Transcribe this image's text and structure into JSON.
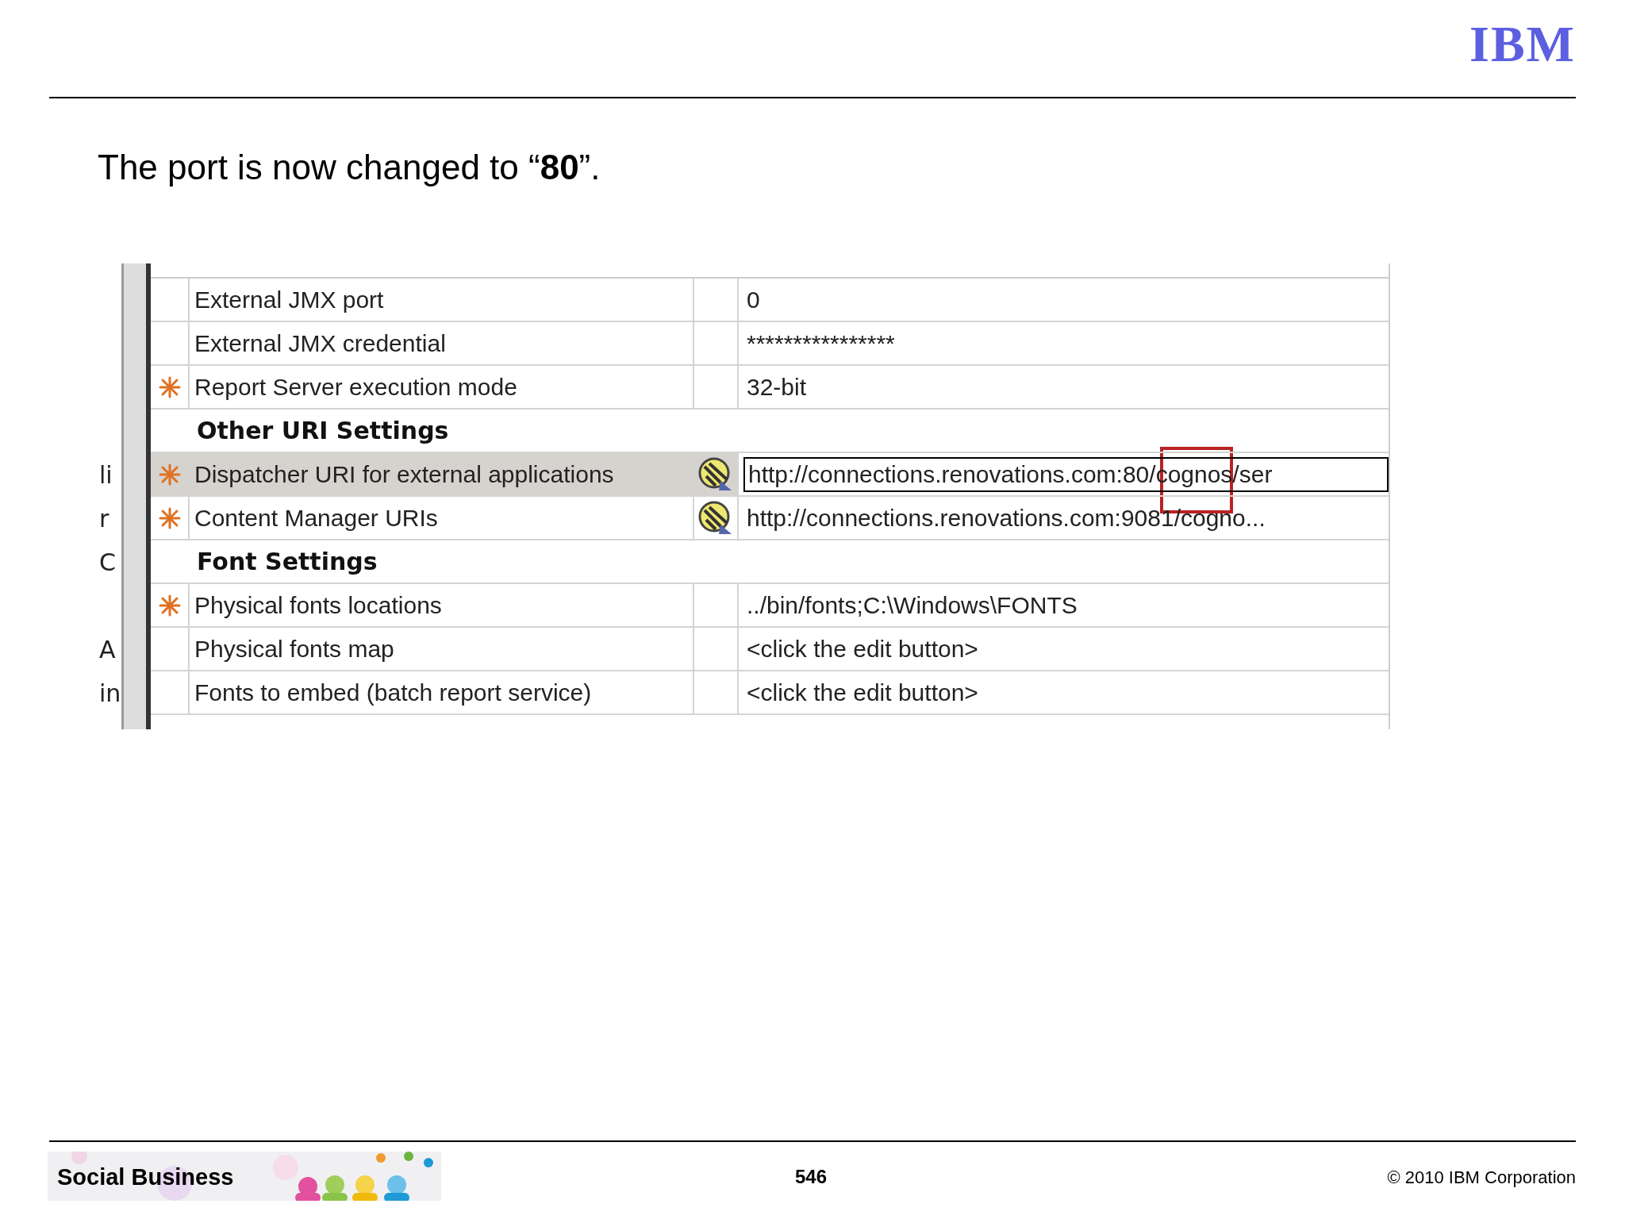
{
  "logo": "IBM",
  "title": "The port is now changed to “**80**”.",
  "table": {
    "rows": [
      {
        "kind": "setting",
        "required": false,
        "name": "External JMX port",
        "has_icon": false,
        "value": "0",
        "selected": false,
        "editing": false
      },
      {
        "kind": "setting",
        "required": false,
        "name": "External JMX credential",
        "has_icon": false,
        "value": "****************",
        "selected": false,
        "editing": false
      },
      {
        "kind": "setting",
        "required": true,
        "name": "Report Server execution mode",
        "has_icon": false,
        "value": "32-bit",
        "selected": false,
        "editing": false
      },
      {
        "kind": "group",
        "name": "Other URI Settings"
      },
      {
        "kind": "setting",
        "required": true,
        "name": "Dispatcher URI for external applications",
        "has_icon": true,
        "value": "http://connections.renovations.com:80/cognos/ser",
        "selected": true,
        "editing": true,
        "callout": true,
        "side_text": "li"
      },
      {
        "kind": "setting",
        "required": true,
        "name": "Content Manager URIs",
        "has_icon": true,
        "value": "http://connections.renovations.com:9081/cogno...",
        "selected": false,
        "editing": false,
        "side_text": "r"
      },
      {
        "kind": "group",
        "name": "Font Settings",
        "side_text": "C"
      },
      {
        "kind": "setting",
        "required": true,
        "name": "Physical fonts locations",
        "has_icon": false,
        "value": "../bin/fonts;C:\\Windows\\FONTS",
        "selected": false,
        "editing": false
      },
      {
        "kind": "setting",
        "required": false,
        "name": "Physical fonts map",
        "has_icon": false,
        "value": "<click the edit button>",
        "selected": false,
        "editing": false,
        "side_text": "A"
      },
      {
        "kind": "setting",
        "required": false,
        "name": "Fonts to embed (batch report service)",
        "has_icon": false,
        "value": "<click the edit button>",
        "selected": false,
        "editing": false,
        "side_text": "in"
      }
    ]
  },
  "footer": {
    "brand": "Social Business",
    "page": "546",
    "copyright": "© 2010 IBM Corporation"
  }
}
